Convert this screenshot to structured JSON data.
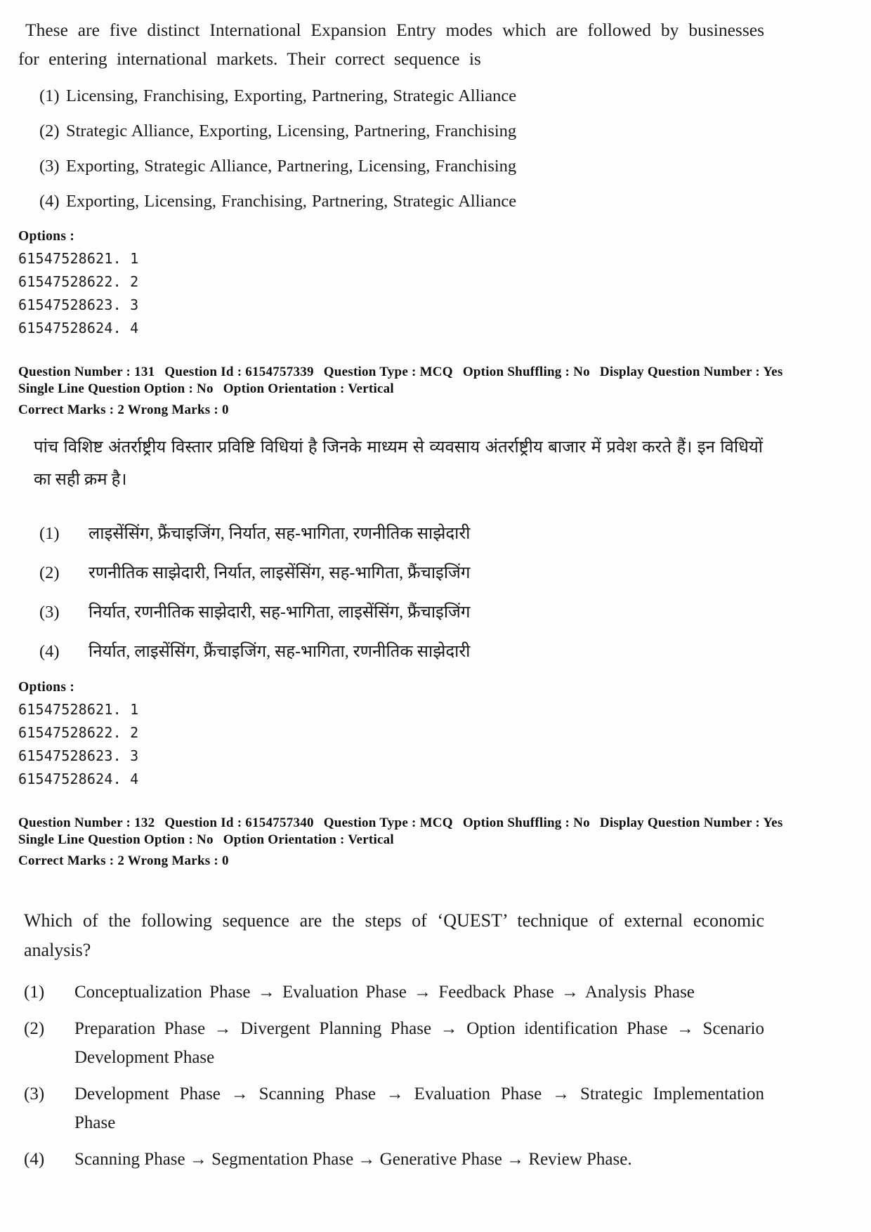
{
  "question_131": {
    "stem_en": "These are five distinct International Expansion Entry modes which are followed by businesses for entering international markets. Their correct sequence is",
    "options_en": [
      {
        "num": "(1)",
        "text": "Licensing, Franchising, Exporting, Partnering, Strategic Alliance"
      },
      {
        "num": "(2)",
        "text": "Strategic Alliance, Exporting, Licensing, Partnering, Franchising"
      },
      {
        "num": "(3)",
        "text": "Exporting, Strategic Alliance,  Partnering, Licensing, Franchising"
      },
      {
        "num": "(4)",
        "text": "Exporting,  Licensing, Franchising, Partnering,  Strategic Alliance"
      }
    ],
    "options_label": "Options :",
    "option_ids_en": [
      "61547528621. 1",
      "61547528622. 2",
      "61547528623. 3",
      "61547528624. 4"
    ],
    "meta": {
      "question_number_label": "Question Number :",
      "question_number": "131",
      "question_id_label": "Question Id :",
      "question_id": "6154757339",
      "question_type_label": "Question Type :",
      "question_type": "MCQ",
      "option_shuffling_label": "Option Shuffling :",
      "option_shuffling": "No",
      "display_question_number_label": "Display Question Number :",
      "display_question_number": "Yes",
      "single_line_label": "Single Line Question Option :",
      "single_line": "No",
      "option_orientation_label": "Option Orientation :",
      "option_orientation": "Vertical",
      "correct_marks_label": "Correct Marks :",
      "correct_marks": "2",
      "wrong_marks_label": "Wrong Marks :",
      "wrong_marks": "0"
    },
    "stem_hi": "पांच विशिष्ट अंतर्राष्ट्रीय विस्तार प्रविष्टि विधियां है जिनके माध्यम से व्यवसाय अंतर्राष्ट्रीय बाजार में प्रवेश करते हैं। इन विधियों का सही क्रम है।",
    "options_hi": [
      {
        "num": "(1)",
        "text": "लाइसेंसिंग, फ्रैंचाइजिंग, निर्यात, सह-भागिता, रणनीतिक साझेदारी"
      },
      {
        "num": "(2)",
        "text": "रणनीतिक साझेदारी, निर्यात, लाइसेंसिंग, सह-भागिता, फ्रैंचाइजिंग"
      },
      {
        "num": "(3)",
        "text": "निर्यात, रणनीतिक साझेदारी, सह-भागिता, लाइसेंसिंग, फ्रैंचाइजिंग"
      },
      {
        "num": "(4)",
        "text": "निर्यात, लाइसेंसिंग, फ्रैंचाइजिंग, सह-भागिता, रणनीतिक साझेदारी"
      }
    ],
    "option_ids_hi": [
      "61547528621. 1",
      "61547528622. 2",
      "61547528623. 3",
      "61547528624. 4"
    ]
  },
  "question_132": {
    "meta": {
      "question_number_label": "Question Number :",
      "question_number": "132",
      "question_id_label": "Question Id :",
      "question_id": "6154757340",
      "question_type_label": "Question Type :",
      "question_type": "MCQ",
      "option_shuffling_label": "Option Shuffling :",
      "option_shuffling": "No",
      "display_question_number_label": "Display Question Number :",
      "display_question_number": "Yes",
      "single_line_label": "Single Line Question Option :",
      "single_line": "No",
      "option_orientation_label": "Option Orientation :",
      "option_orientation": "Vertical",
      "correct_marks_label": "Correct Marks :",
      "correct_marks": "2",
      "wrong_marks_label": "Wrong Marks :",
      "wrong_marks": "0"
    },
    "stem_en": "Which of the following sequence are the steps of ‘QUEST’ technique of external economic analysis?",
    "options_en": [
      {
        "num": "(1)",
        "text": "Conceptualization Phase  →   Evaluation Phase  →  Feedback Phase  →  Analysis Phase"
      },
      {
        "num": "(2)",
        "text": "Preparation Phase → Divergent Planning Phase → Option identification Phase → Scenario Development Phase"
      },
      {
        "num": "(3)",
        "text": "Development  Phase  →  Scanning  Phase  →  Evaluation  Phase  →  Strategic Implementation Phase"
      },
      {
        "num": "(4)",
        "text": "Scanning Phase → Segmentation Phase → Generative Phase → Review Phase."
      }
    ]
  }
}
